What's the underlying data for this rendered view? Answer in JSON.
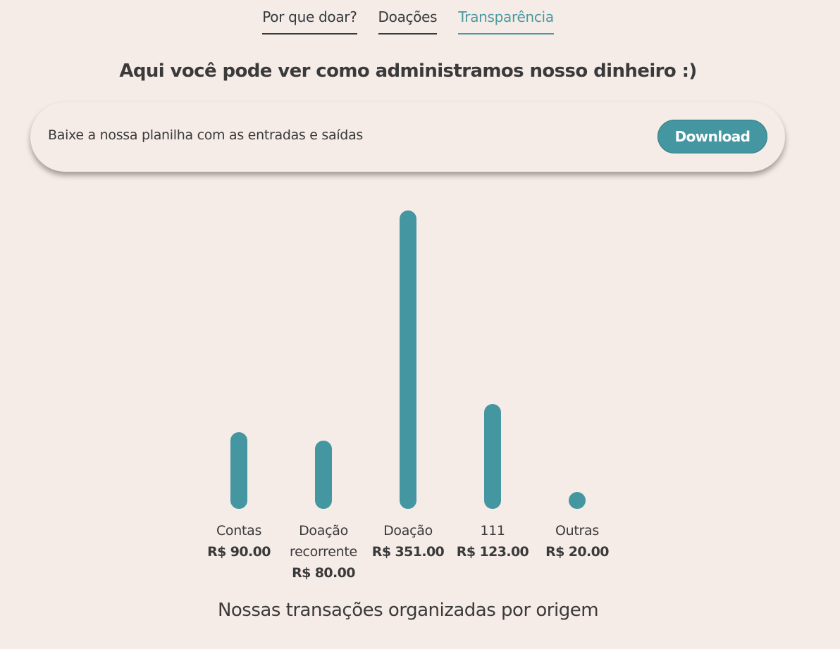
{
  "tabs": [
    {
      "label": "Por que doar?",
      "active": false
    },
    {
      "label": "Doações",
      "active": false
    },
    {
      "label": "Transparência",
      "active": true
    }
  ],
  "page_title": "Aqui você pode ver como administramos nosso dinheiro :)",
  "download_card": {
    "text": "Baixe a nossa planilha com as entradas e saídas",
    "button_label": "Download"
  },
  "colors": {
    "accent": "#4496a0",
    "background": "#f5ebe7",
    "text": "#3a3a3a"
  },
  "chart_data": {
    "type": "bar",
    "categories": [
      "Contas",
      "Doação recorrente",
      "Doação",
      "111",
      "Outras"
    ],
    "values": [
      90,
      80,
      351,
      123,
      20
    ],
    "value_labels": [
      "R$ 90.00",
      "R$ 80.00",
      "R$ 351.00",
      "R$ 123.00",
      "R$ 20.00"
    ],
    "caption": "Nossas transações organizadas por origem",
    "grid": false,
    "legend": "none"
  }
}
